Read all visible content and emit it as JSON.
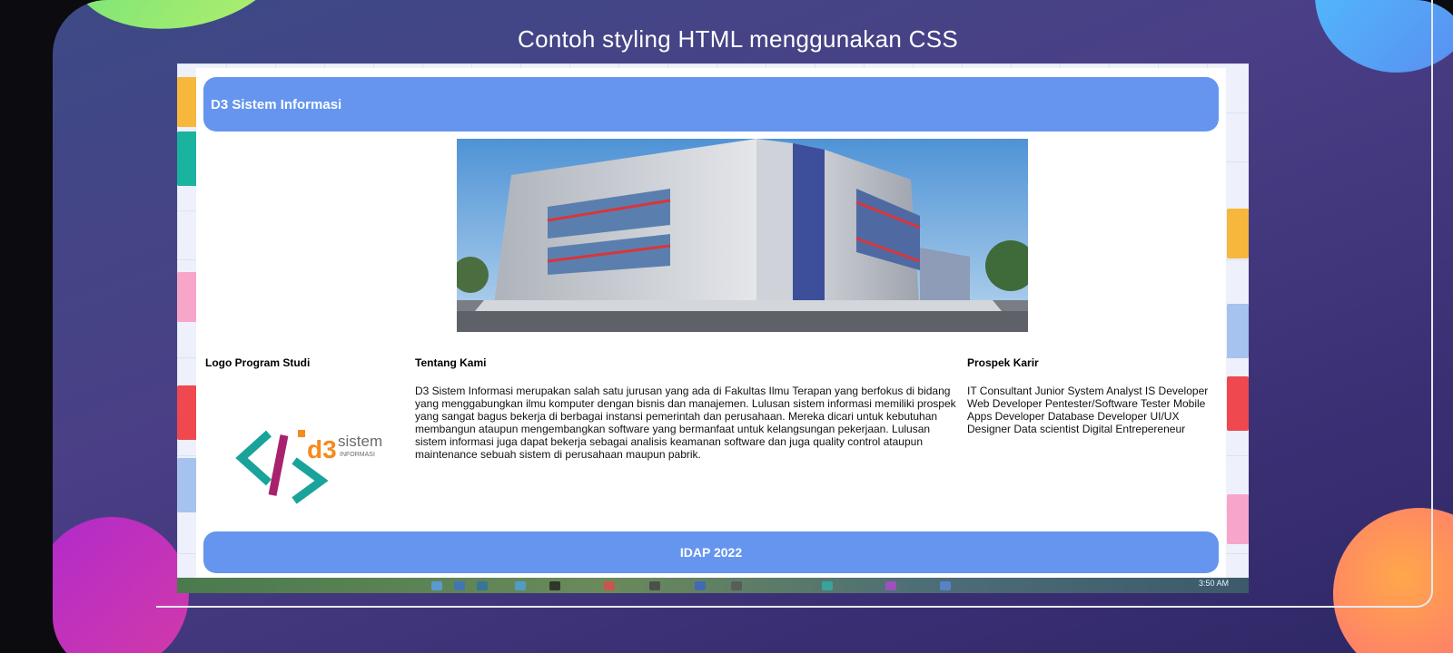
{
  "slide": {
    "title": "Contoh styling HTML menggunakan CSS"
  },
  "page": {
    "header_title": "D3 Sistem Informasi",
    "hero_alt": "Gedung kampus",
    "logo_section": {
      "heading": "Logo Program Studi",
      "logo_text_main": "d3",
      "logo_text_sistem": "sistem",
      "logo_text_informasi": "INFORMASI"
    },
    "about_section": {
      "heading": "Tentang Kami",
      "body": "D3 Sistem Informasi merupakan salah satu jurusan yang ada di Fakultas Ilmu Terapan yang berfokus di bidang yang menggabungkan ilmu komputer dengan bisnis dan manajemen. Lulusan sistem informasi memiliki prospek yang sangat bagus bekerja di berbagai instansi pemerintah dan perusahaan. Mereka dicari untuk kebutuhan membangun ataupun mengembangkan software yang bermanfaat untuk kelangsungan pekerjaan. Lulusan sistem informasi juga dapat bekerja sebagai analisis keamanan software dan juga quality control ataupun maintenance sebuah sistem di perusahaan maupun pabrik."
    },
    "career_section": {
      "heading": "Prospek Karir",
      "body": "IT Consultant Junior System Analyst IS Developer Web Developer Pentester/Software Tester Mobile Apps Developer Database Developer UI/UX Designer Data scientist Digital Entrepereneur"
    },
    "footer_text": "IDAP 2022"
  },
  "taskbar": {
    "clock": "3:50 AM"
  },
  "colors": {
    "accent_blue": "#6595ee",
    "logo_teal": "#1aa39a",
    "logo_magenta": "#a8226e",
    "logo_orange": "#f58a1f"
  }
}
